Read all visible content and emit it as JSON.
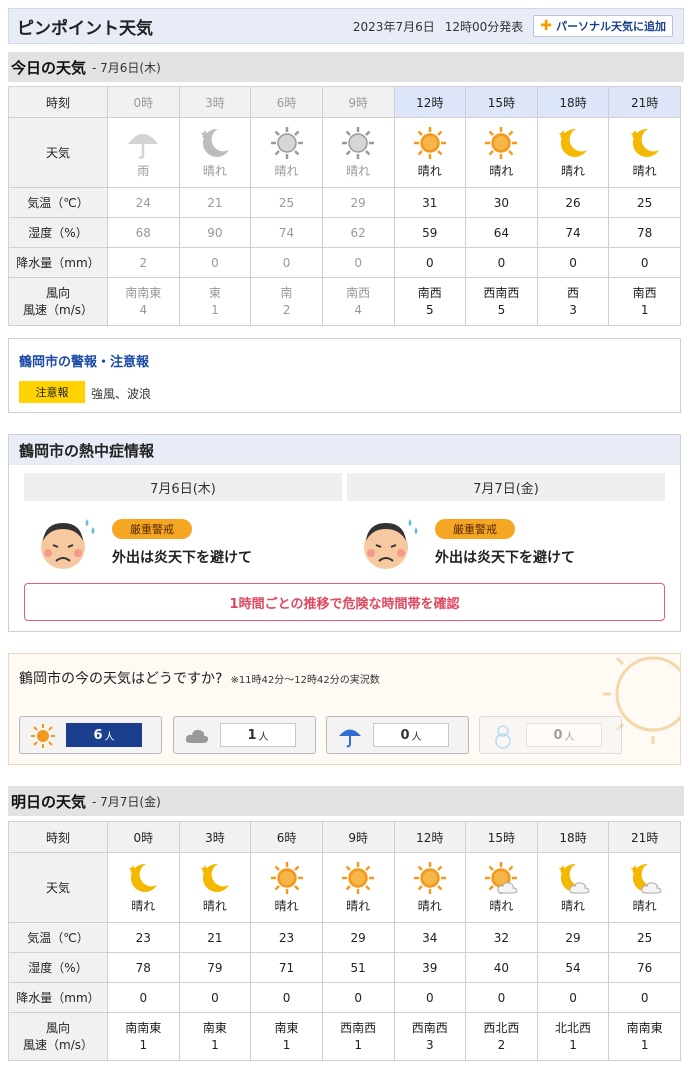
{
  "header": {
    "title": "ピンポイント天気",
    "publish_date": "2023年7月6日",
    "publish_time": "12時00分発表",
    "add_button": "パーソナル天気に追加"
  },
  "today": {
    "heading": "今日の天気",
    "date": "- 7月6日(木)",
    "labels": {
      "time": "時刻",
      "weather": "天気",
      "temp": "気温（℃）",
      "humidity": "湿度（%）",
      "precip": "降水量（mm）",
      "wind_dir": "風向",
      "wind_speed": "風速（m/s）"
    },
    "times": [
      "0時",
      "3時",
      "6時",
      "9時",
      "12時",
      "15時",
      "18時",
      "21時"
    ],
    "weather": [
      "雨",
      "晴れ",
      "晴れ",
      "晴れ",
      "晴れ",
      "晴れ",
      "晴れ",
      "晴れ"
    ],
    "icons": [
      "umbrella-icon",
      "moon-icon",
      "sun-icon",
      "sun-icon",
      "sun-icon",
      "sun-icon",
      "moon-icon",
      "moon-icon"
    ],
    "temp": [
      "24",
      "21",
      "25",
      "29",
      "31",
      "30",
      "26",
      "25"
    ],
    "humidity": [
      "68",
      "90",
      "74",
      "62",
      "59",
      "64",
      "74",
      "78"
    ],
    "precip": [
      "2",
      "0",
      "0",
      "0",
      "0",
      "0",
      "0",
      "0"
    ],
    "wind_dir": [
      "南南東",
      "東",
      "南",
      "南西",
      "南西",
      "西南西",
      "西",
      "南西"
    ],
    "wind_speed": [
      "4",
      "1",
      "2",
      "4",
      "5",
      "5",
      "3",
      "1"
    ]
  },
  "warning": {
    "title": "鶴岡市の警報・注意報",
    "tag": "注意報",
    "text": "強風、波浪"
  },
  "heat": {
    "title": "鶴岡市の熱中症情報",
    "days": [
      {
        "date": "7月6日(木)",
        "level": "厳重警戒",
        "message": "外出は炎天下を避けて"
      },
      {
        "date": "7月7日(金)",
        "level": "厳重警戒",
        "message": "外出は炎天下を避けて"
      }
    ],
    "link": "1時間ごとの推移で危険な時間帯を確認"
  },
  "now": {
    "question": "鶴岡市の今の天気はどうですか?",
    "note": "※11時42分～12時42分の実況数",
    "unit": "人",
    "votes": [
      {
        "icon": "sun-icon",
        "count": "6"
      },
      {
        "icon": "cloud-icon",
        "count": "1"
      },
      {
        "icon": "umbrella-icon",
        "count": "0"
      },
      {
        "icon": "snowman-icon",
        "count": "0"
      }
    ]
  },
  "tomorrow": {
    "heading": "明日の天気",
    "date": "- 7月7日(金)",
    "labels": {
      "time": "時刻",
      "weather": "天気",
      "temp": "気温（℃）",
      "humidity": "湿度（%）",
      "precip": "降水量（mm）",
      "wind_dir": "風向",
      "wind_speed": "風速（m/s）"
    },
    "times": [
      "0時",
      "3時",
      "6時",
      "9時",
      "12時",
      "15時",
      "18時",
      "21時"
    ],
    "weather": [
      "晴れ",
      "晴れ",
      "晴れ",
      "晴れ",
      "晴れ",
      "晴れ",
      "晴れ",
      "晴れ"
    ],
    "icons": [
      "moon-icon",
      "moon-icon",
      "sun-icon",
      "sun-icon",
      "sun-icon",
      "sun-cloud-icon",
      "moon-cloud-icon",
      "moon-cloud-icon"
    ],
    "temp": [
      "23",
      "21",
      "23",
      "29",
      "34",
      "32",
      "29",
      "25"
    ],
    "humidity": [
      "78",
      "79",
      "71",
      "51",
      "39",
      "40",
      "54",
      "76"
    ],
    "precip": [
      "0",
      "0",
      "0",
      "0",
      "0",
      "0",
      "0",
      "0"
    ],
    "wind_dir": [
      "南南東",
      "南東",
      "南東",
      "西南西",
      "西南西",
      "西北西",
      "北北西",
      "南南東"
    ],
    "wind_speed": [
      "1",
      "1",
      "1",
      "1",
      "3",
      "2",
      "1",
      "1"
    ]
  },
  "colors": {
    "accent": "#1b3e8f",
    "sun": "#f39a1e",
    "moon": "#f5b800",
    "caution": "#ffd200",
    "heat": "#f5a623"
  }
}
